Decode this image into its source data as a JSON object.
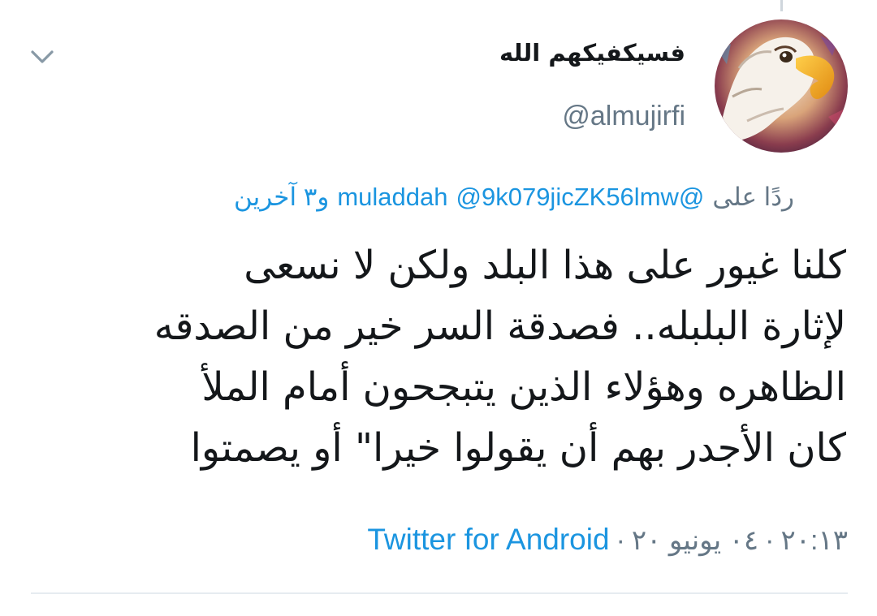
{
  "tweet": {
    "author": {
      "display_name": "فسيكفيكهم الله",
      "handle": "@almujirfi",
      "avatar_icon": "eagle-avatar"
    },
    "menu_icon": "chevron-down-icon",
    "reply": {
      "prefix": "ردًا على",
      "mention_1": "@muladdah",
      "mention_2": "@9k079jicZK56lmw",
      "others": "و٣ آخرين"
    },
    "text_lines": [
      "كلنا غيور على هذا البلد ولكن لا نسعى",
      "لإثارة البلبله.. فصدقة السر خير من الصدقه",
      "الظاهره وهؤلاء الذين يتبجحون أمام الملأ",
      "كان الأجدر بهم أن يقولوا خيرا\" أو يصمتوا"
    ],
    "time": "٢٠:١٣",
    "date": "٠٤ يونيو ٢٠",
    "source": "Twitter for Android",
    "separator": "·"
  },
  "colors": {
    "link_blue": "#1b95e0",
    "secondary_gray": "#657786",
    "text_dark": "#14171a",
    "divider": "#e6ecf0"
  }
}
